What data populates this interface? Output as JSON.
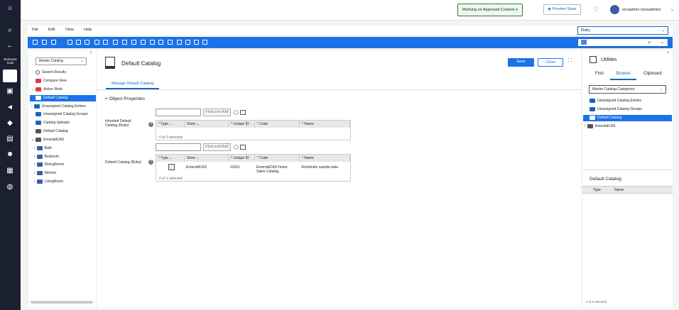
{
  "rail": {
    "business_tools": "Business tools"
  },
  "header": {
    "working_status": "Working on Approved Content",
    "preview_store": "Preview Store",
    "user": "wcsadmin (wcsadmin)"
  },
  "menu": [
    "File",
    "Edit",
    "View",
    "Help"
  ],
  "store_select": "Ruby",
  "left_panel": {
    "catalog_select": "Master Catalog",
    "items": [
      "Search Results",
      "Compare View",
      "Active Work",
      "Default Catalog",
      "Unassigned Catalog Entries",
      "Unassigned Catalog Groups",
      "Catalog Uploads",
      "Default Catalog",
      "EmeraldCAS",
      "Bath",
      "Bedroom",
      "DiningRoom",
      "Kitchen",
      "LivingRoom"
    ]
  },
  "editor": {
    "title": "Default Catalog",
    "save": "Save",
    "close": "Close",
    "tab": "Manage Default Catalog",
    "section": "Object Properties",
    "find_add": "Find and Add",
    "inherited_label": "Inherited Default Catalog (Ruby)",
    "default_label": "Default Catalog (Ruby)",
    "columns": [
      "* Type",
      "Store",
      "* Unique ID",
      "* Code",
      "* Name"
    ],
    "grid1_footer": "0 of 0 selected",
    "grid2_row": {
      "store": "EmeraldCAS",
      "unique_id": "11501",
      "code": "EmeraldCAS Home Sales Catalog",
      "name": "Stockholm sample data"
    },
    "grid2_footer": "0 of 1 selected"
  },
  "utilities": {
    "title": "Utilities",
    "tabs": [
      "Find",
      "Browse",
      "Clipboard"
    ],
    "select": "Master Catalog Categories",
    "items": [
      "Unassigned Catalog Entries",
      "Unassigned Catalog Groups",
      "Default Catalog",
      "EmeraldCAS"
    ],
    "bottom_title": "Default Catalog",
    "cols": [
      "Type",
      "Name"
    ],
    "footer": "0 of 0 selected"
  }
}
